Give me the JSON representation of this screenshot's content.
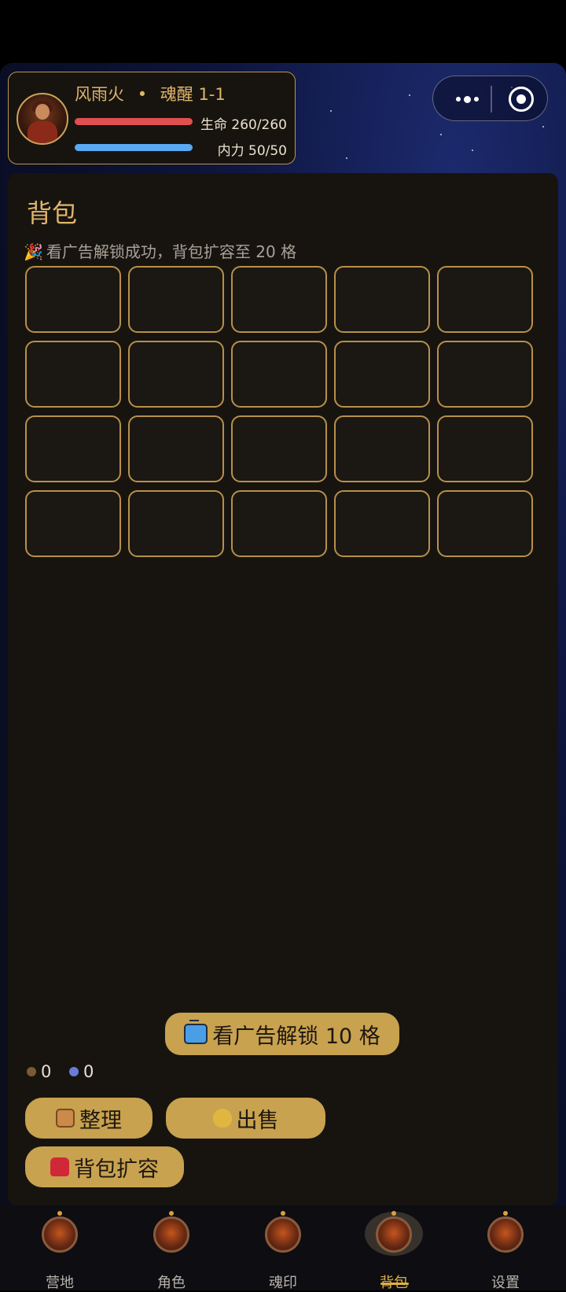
{
  "player": {
    "name": "风雨火",
    "separator": "•",
    "stage": "魂醒 1-1",
    "hp_label": "生命 260/260",
    "mp_label": "内力 50/50",
    "hp_fraction": 1.0,
    "mp_fraction": 1.0
  },
  "capsule": {
    "more_icon": "more-dots-icon",
    "close_icon": "record-circle-icon"
  },
  "bag": {
    "title": "背包",
    "notice": "看广告解锁成功，背包扩容至 20 格",
    "slots": 20,
    "ad_button_label": "看广告解锁 10 格",
    "currency_1": "0",
    "currency_2": "0",
    "sort_label": "整理",
    "sell_label": "出售",
    "expand_label": "背包扩容"
  },
  "nav": {
    "items": [
      {
        "label": "营地"
      },
      {
        "label": "角色"
      },
      {
        "label": "魂印"
      },
      {
        "label": "背包"
      },
      {
        "label": "设置"
      }
    ],
    "active_index": 3
  },
  "colors": {
    "accent_gold": "#c8a24f",
    "hp_red": "#e05050",
    "mp_blue": "#5aa8f2",
    "panel_bg": "#171410"
  }
}
